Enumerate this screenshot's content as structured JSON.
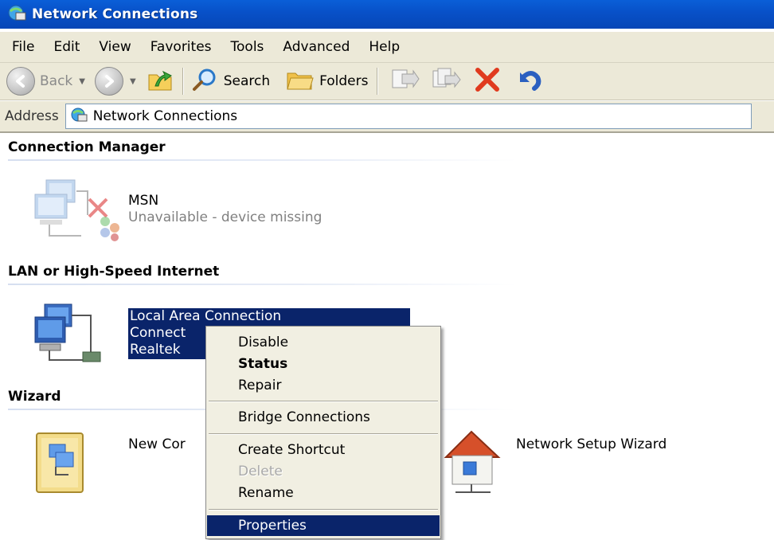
{
  "window": {
    "title": "Network Connections"
  },
  "menubar": {
    "items": [
      "File",
      "Edit",
      "View",
      "Favorites",
      "Tools",
      "Advanced",
      "Help"
    ]
  },
  "toolbar": {
    "back_label": "Back",
    "search_label": "Search",
    "folders_label": "Folders"
  },
  "address": {
    "label": "Address",
    "value": "Network Connections"
  },
  "groups": {
    "connection_manager": {
      "title": "Connection Manager",
      "item": {
        "name": "MSN",
        "status": "Unavailable - device missing"
      }
    },
    "lan": {
      "title": "LAN or High-Speed Internet",
      "item": {
        "name": "Local Area Connection",
        "status_partial": "Connect",
        "device_partial": "Realtek"
      }
    },
    "wizard": {
      "title": "Wizard",
      "items": [
        {
          "name_partial": "New Cor"
        },
        {
          "name": "Network Setup Wizard"
        }
      ]
    }
  },
  "context_menu": {
    "items": [
      {
        "label": "Disable"
      },
      {
        "label": "Status"
      },
      {
        "label": "Repair"
      },
      {
        "label": "Bridge Connections"
      },
      {
        "label": "Create Shortcut"
      },
      {
        "label": "Delete"
      },
      {
        "label": "Rename"
      },
      {
        "label": "Properties"
      }
    ]
  },
  "colors": {
    "selection": "#0a246a",
    "titlebar": "#0a5fd8",
    "chrome": "#ece9d8"
  }
}
